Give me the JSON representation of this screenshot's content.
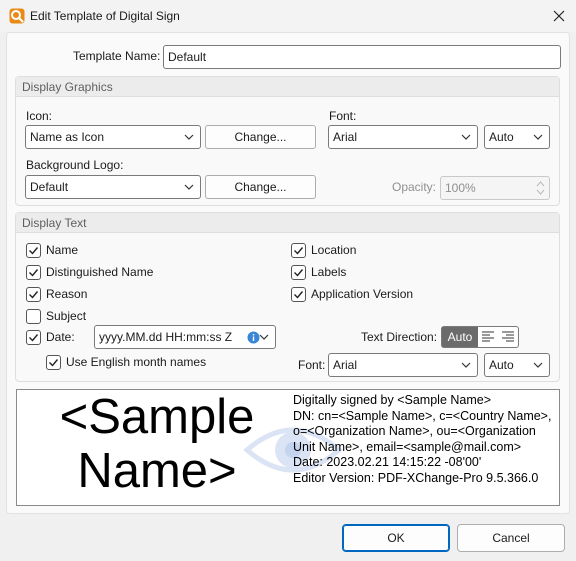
{
  "window": {
    "title": "Edit Template of Digital Sign",
    "icon": "pdf-xchange-app-icon",
    "close_icon": "close-icon"
  },
  "template_name": {
    "label": "Template Name:",
    "value": "Default"
  },
  "display_graphics": {
    "header": "Display Graphics",
    "icon_label": "Icon:",
    "icon_value": "Name as Icon",
    "icon_change_button": "Change...",
    "font_label": "Font:",
    "font_value": "Arial",
    "font_size_value": "Auto",
    "background_logo_label": "Background Logo:",
    "background_logo_value": "Default",
    "background_change_button": "Change...",
    "opacity_label": "Opacity:",
    "opacity_value": "100%"
  },
  "display_text": {
    "header": "Display Text",
    "options_left": [
      {
        "label": "Name",
        "checked": true
      },
      {
        "label": "Distinguished Name",
        "checked": true
      },
      {
        "label": "Reason",
        "checked": true
      },
      {
        "label": "Subject",
        "checked": false
      },
      {
        "label": "Date:",
        "checked": true
      }
    ],
    "options_right": [
      {
        "label": "Location",
        "checked": true
      },
      {
        "label": "Labels",
        "checked": true
      },
      {
        "label": "Application Version",
        "checked": true
      }
    ],
    "date_format_value": "yyyy.MM.dd HH:mm:ss Z",
    "english_month_label": "Use English month names",
    "english_month_checked": true,
    "text_direction_label": "Text Direction:",
    "text_direction_selected": "Auto",
    "font_label": "Font:",
    "font_value": "Arial",
    "font_size_value": "Auto"
  },
  "preview": {
    "name_text": "<Sample Name>",
    "name_line1": "<Sample",
    "name_line2": "Name>",
    "details": "Digitally signed by <Sample Name>\nDN: cn=<Sample Name>, c=<Country Name>, o=<Organization Name>, ou=<Organization Unit Name>, email=<sample@mail.com>\nDate: 2023.02.21 14:15:22 -08'00'\nEditor Version: PDF-XChange-Pro 9.5.366.0",
    "watermark_icon": "eye-watermark-icon"
  },
  "footer": {
    "ok_button": "OK",
    "cancel_button": "Cancel"
  },
  "colors": {
    "accent": "#0067c0",
    "selected_segment": "#6b6b6b",
    "watermark": "#dbe4f4"
  }
}
